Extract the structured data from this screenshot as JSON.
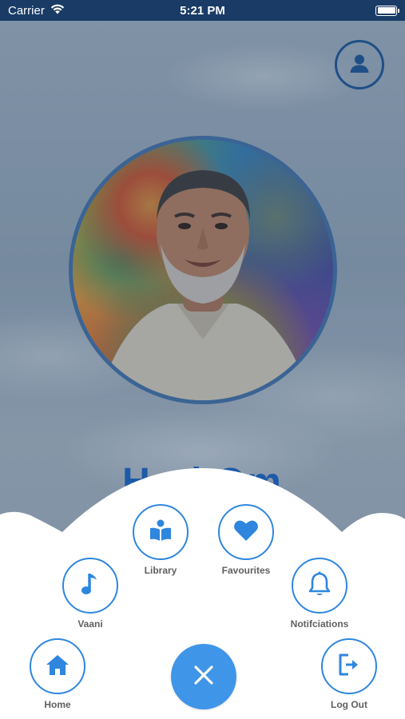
{
  "status_bar": {
    "carrier": "Carrier",
    "time": "5:21 PM"
  },
  "page": {
    "heading": "Hari Om"
  },
  "menu": {
    "items": [
      {
        "id": "library",
        "label": "Library",
        "icon": "book-reader-icon"
      },
      {
        "id": "favourites",
        "label": "Favourites",
        "icon": "heart-icon"
      },
      {
        "id": "vaani",
        "label": "Vaani",
        "icon": "music-note-icon"
      },
      {
        "id": "notifications",
        "label": "Notifciations",
        "icon": "bell-icon"
      },
      {
        "id": "home",
        "label": "Home",
        "icon": "home-icon"
      },
      {
        "id": "logout",
        "label": "Log Out",
        "icon": "logout-icon"
      }
    ],
    "close_icon": "close-icon"
  },
  "colors": {
    "status_bar": "#193b66",
    "accent": "#2e86de",
    "fab": "#3f95e8",
    "label": "#606060",
    "profile_ring": "#1f4f86"
  }
}
